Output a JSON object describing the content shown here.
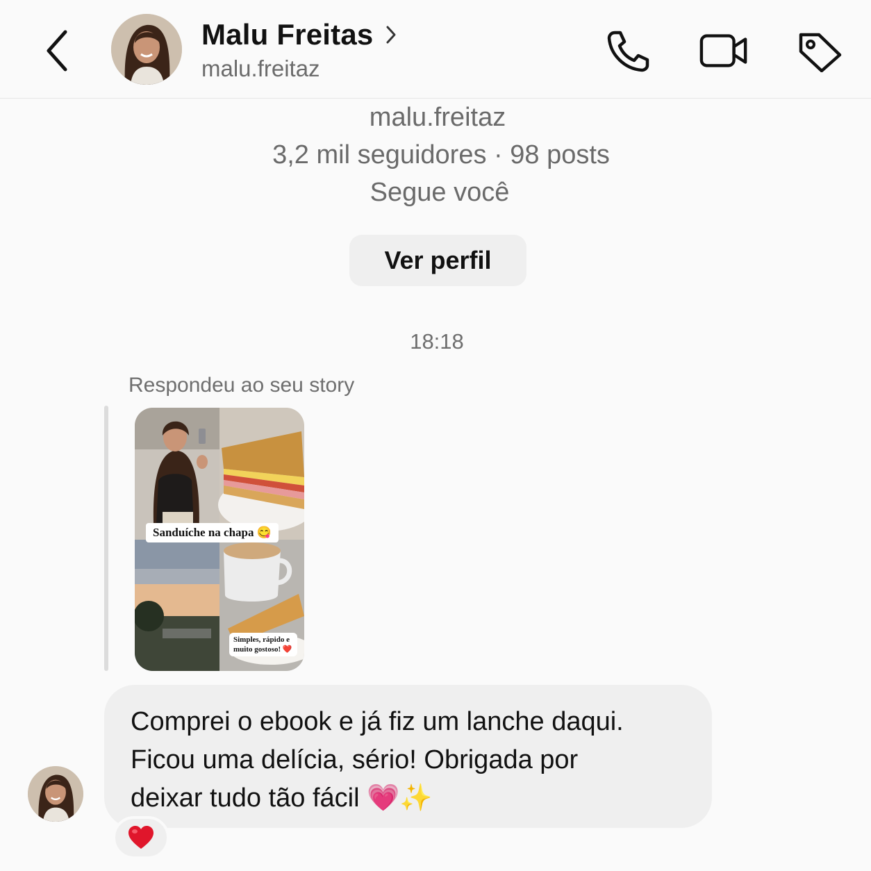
{
  "header": {
    "name": "Malu Freitas",
    "username": "malu.freitaz",
    "icons": {
      "back": "chevron-left-icon",
      "name_chevron": "chevron-right-icon",
      "call": "phone-icon",
      "video": "video-camera-icon",
      "tag": "tag-icon"
    }
  },
  "profile": {
    "username": "malu.freitaz",
    "stats": "3,2 mil seguidores · 98 posts",
    "follow_status": "Segue você",
    "view_profile_label": "Ver perfil"
  },
  "conversation": {
    "timestamp": "18:18",
    "story_reply_label": "Respondeu ao seu story",
    "story": {
      "caption_1": "Sanduíche na chapa 😋",
      "caption_2": "Simples, rápido e muito gostoso! ❤️"
    },
    "message": {
      "line_1": "Comprei o ebook e já fiz um lanche daqui.",
      "line_2": "Ficou uma delícia, sério! Obrigada por",
      "line_3": "deixar tudo tão fácil 💗✨"
    },
    "reaction": "❤️"
  },
  "colors": {
    "background": "#fafafa",
    "bubble": "#efefef",
    "secondary_text": "#6a6a6a",
    "reaction_heart": "#e0162b"
  }
}
